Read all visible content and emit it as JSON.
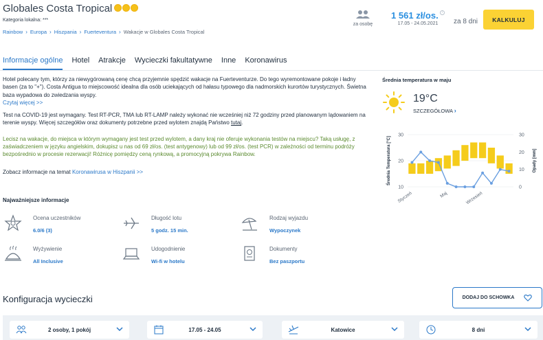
{
  "header": {
    "hotel_name": "Globales Costa Tropical",
    "category_label": "Kategoria lokalna: ***",
    "breadcrumb": [
      "Rainbow",
      "Europa",
      "Hiszpania",
      "Fuerteventura"
    ],
    "breadcrumb_current": "Wakacje w Globales Costa Tropical",
    "persons_label": "za osobę",
    "price": "1 561 zł/os.",
    "price_info": "i",
    "price_dates": "17.05 - 24.05.2021",
    "duration": "za 8 dni",
    "calc_button": "KALKULUJ"
  },
  "tabs": [
    {
      "label": "Informacje ogólne",
      "active": true
    },
    {
      "label": "Hotel",
      "active": false
    },
    {
      "label": "Atrakcje",
      "active": false
    },
    {
      "label": "Wycieczki fakultatywne",
      "active": false
    },
    {
      "label": "Inne",
      "active": false
    },
    {
      "label": "Koronawirus",
      "active": false
    }
  ],
  "description": {
    "paragraph1": "Hotel polecany tym, którzy za niewygórowaną cenę chcą przyjemnie spędzić wakacje na Fuerteventurze. Do tego wyremontowane pokoje i ładny basen (za to \"+\"). Costa Antigua to miejscowość idealna dla osób uciekających od hałasu typowego dla nadmorskich kurortów turystycznych. Świetna baza wypadowa do zwiedzania wyspy.",
    "read_more": "Czytaj więcej >>",
    "covid_text": "Test na COVID-19 jest wymagany. Test RT-PCR, TMA lub RT-LAMP należy wykonać nie wcześniej niż 72 godziny przed planowanym lądowaniem na terenie wyspy. Więcej szczegółów oraz dokumenty potrzebne przed wylotem znajdą Państwo ",
    "covid_link": "tutaj",
    "covid_end": ".",
    "green_text": "Lecisz na wakacje, do miejsca w którym wymagany jest test przed wylotem, a dany kraj nie oferuje wykonania testów na miejscu? Taką usługę, z zaświadczeniem w języku angielskim, dokupisz u nas od 69 zł/os. (test antygenowy) lub od 99 zł/os. (test PCR) w zależności od terminu podróży bezpośrednio w procesie rezerwacji! Różnicę pomiędzy ceną rynkową, a promocyjną pokrywa Rainbow.",
    "corona_prefix": "Zobacz informacje na temat ",
    "corona_link": "Koronawirusa w Hiszpanii >>"
  },
  "key_info": {
    "title": "Najważniejsze informacje",
    "items": [
      {
        "label": "Ocena uczestników",
        "value": "6.0/6 (3)",
        "icon": "rating-star-icon"
      },
      {
        "label": "Długość lotu",
        "value": "5 godz. 15 min.",
        "icon": "airplane-icon"
      },
      {
        "label": "Rodzaj wyjazdu",
        "value": "Wypoczynek",
        "icon": "beach-umbrella-icon"
      },
      {
        "label": "Wyżywienie",
        "value": "All Inclusive",
        "icon": "food-cloche-icon"
      },
      {
        "label": "Udogodnienie",
        "value": "Wi-fi w hotelu",
        "icon": "laptop-icon"
      },
      {
        "label": "Dokumenty",
        "value": "Bez paszportu",
        "icon": "passport-icon"
      }
    ]
  },
  "weather": {
    "title": "Średnia temperatura w maju",
    "temperature": "19°C",
    "details": "SZCZEGÓŁOWA",
    "details_chevron": "›"
  },
  "chart_data": {
    "type": "bar",
    "left_axis_label": "Średnia Temperatura [°C]",
    "right_axis_label": "Opady [mm]",
    "left_ylim": [
      10,
      30
    ],
    "right_ylim": [
      0,
      30
    ],
    "left_ticks": [
      "10",
      "20",
      "30"
    ],
    "right_ticks": [
      "0",
      "10",
      "20",
      "30"
    ],
    "x_ticks": [
      "Styczeń",
      "Maj",
      "Wrzesień"
    ],
    "x_tick_months": [
      1,
      5,
      9
    ],
    "temperature_bars": [
      {
        "month": 1,
        "min": 15,
        "max": 19
      },
      {
        "month": 2,
        "min": 15,
        "max": 19
      },
      {
        "month": 3,
        "min": 15,
        "max": 20
      },
      {
        "month": 4,
        "min": 16,
        "max": 21
      },
      {
        "month": 5,
        "min": 17,
        "max": 22
      },
      {
        "month": 6,
        "min": 18,
        "max": 24
      },
      {
        "month": 7,
        "min": 20,
        "max": 26
      },
      {
        "month": 8,
        "min": 21,
        "max": 27
      },
      {
        "month": 9,
        "min": 21,
        "max": 27
      },
      {
        "month": 10,
        "min": 19,
        "max": 25
      },
      {
        "month": 11,
        "min": 17,
        "max": 22
      },
      {
        "month": 12,
        "min": 15,
        "max": 19
      }
    ],
    "precipitation": [
      {
        "month": 1,
        "value": 14
      },
      {
        "month": 2,
        "value": 20
      },
      {
        "month": 3,
        "value": 15
      },
      {
        "month": 4,
        "value": 14
      },
      {
        "month": 5,
        "value": 2
      },
      {
        "month": 6,
        "value": 0
      },
      {
        "month": 7,
        "value": 0
      },
      {
        "month": 8,
        "value": 0
      },
      {
        "month": 9,
        "value": 8
      },
      {
        "month": 10,
        "value": 2
      },
      {
        "month": 11,
        "value": 10
      },
      {
        "month": 12,
        "value": 9
      }
    ],
    "colors": {
      "bars": "#f5cc1b",
      "line": "#6a9fe0",
      "grid": "#e4e7eb",
      "axis_text": "#5a6573"
    }
  },
  "config": {
    "title": "Konfiguracja wycieczki",
    "add_to_clipboard": "DODAJ DO SCHOWKA",
    "selectors": [
      {
        "label": "2 osoby, 1 pokój",
        "icon": "people-icon"
      },
      {
        "label": "17.05 - 24.05",
        "icon": "calendar-icon"
      },
      {
        "label": "Katowice",
        "icon": "plane-departure-icon"
      },
      {
        "label": "8 dni",
        "icon": "clock-icon"
      }
    ]
  },
  "colors": {
    "accent": "#2a78c8",
    "price": "#2a8fe0",
    "button": "#fbd234",
    "green_text": "#5a8a2e"
  }
}
